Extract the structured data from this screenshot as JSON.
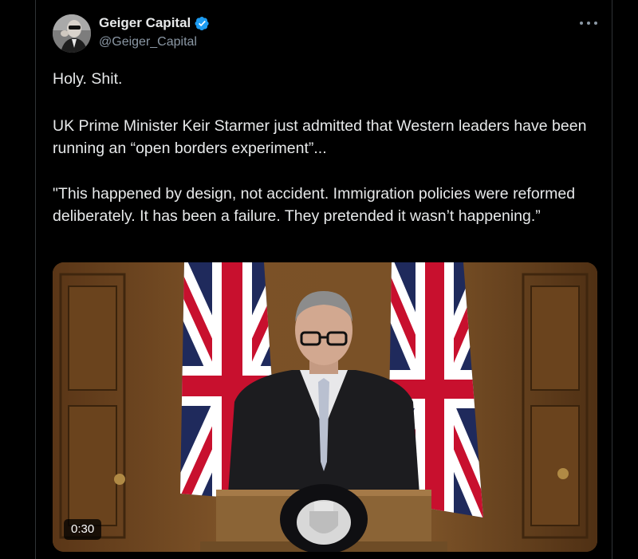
{
  "tweet": {
    "author": {
      "display_name": "Geiger Capital",
      "handle": "@Geiger_Capital",
      "verified": true,
      "verified_color": "#1d9bf0"
    },
    "paragraphs": [
      "Holy. Shit.",
      "UK Prime Minister Keir Starmer just admitted that Western leaders have been running an “open borders experiment”...",
      "\"This happened by design, not accident. Immigration policies were reformed deliberately. It has been a failure. They pretended it wasn’t happening.”"
    ],
    "media": {
      "type": "video",
      "duration": "0:30"
    }
  },
  "icons": {
    "more": "more-horizontal-icon",
    "verified": "verified-badge-icon"
  },
  "colors": {
    "background": "#000000",
    "text": "#e7e9ea",
    "secondary_text": "#8b98a5",
    "divider": "#2f3336"
  }
}
